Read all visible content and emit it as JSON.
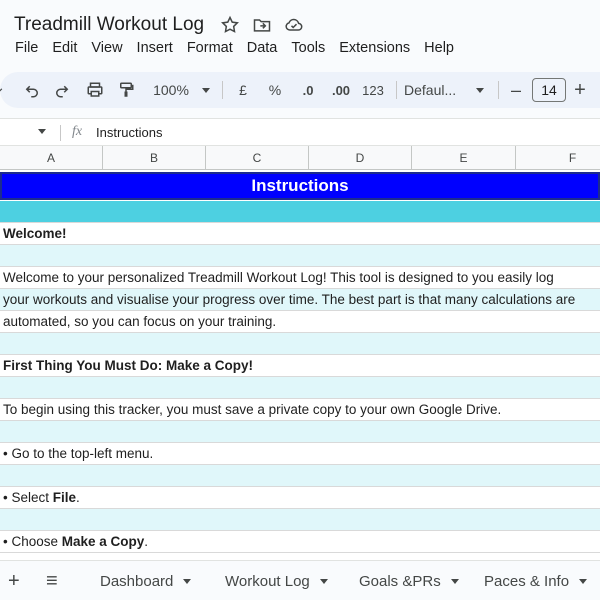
{
  "app": {
    "title": "Treadmill Workout Log"
  },
  "menu": [
    "File",
    "Edit",
    "View",
    "Insert",
    "Format",
    "Data",
    "Tools",
    "Extensions",
    "Help"
  ],
  "toolbar": {
    "zoom": "100%",
    "currency": "£",
    "percent": "%",
    "dec_decrease": ".0",
    "dec_increase": ".00",
    "number_format": "123",
    "font": "Defaul...",
    "font_size": "14",
    "minus": "–",
    "plus": "+"
  },
  "formula_bar": {
    "fx": "fx",
    "content": "Instructions"
  },
  "columns": [
    "A",
    "B",
    "C",
    "D",
    "E",
    "F"
  ],
  "rows": [
    {
      "text": "Instructions",
      "style": "header"
    },
    {
      "text": "",
      "style": "teal"
    },
    {
      "text": "Welcome!",
      "style": "light",
      "bold": true
    },
    {
      "text": "",
      "style": "cyan"
    },
    {
      "text": "Welcome to your personalized Treadmill Workout Log! This tool is designed to you easily log",
      "style": "light"
    },
    {
      "text": "your workouts and visualise your progress over time. The best part is that many calculations are",
      "style": "cyan"
    },
    {
      "text": "automated, so you can focus on your training.",
      "style": "light"
    },
    {
      "text": "",
      "style": "cyan"
    },
    {
      "text": "First Thing You Must Do: Make a Copy!",
      "style": "light",
      "bold": true
    },
    {
      "text": "",
      "style": "cyan"
    },
    {
      "text": "To begin using this tracker, you must save a private copy to your own Google Drive.",
      "style": "light"
    },
    {
      "text": "",
      "style": "cyan"
    },
    {
      "text": "• Go to the top-left menu.",
      "style": "light"
    },
    {
      "text": "",
      "style": "cyan"
    },
    {
      "text_prefix": "• Select ",
      "text_bold": "File",
      "text_suffix": ".",
      "style": "light"
    },
    {
      "text": "",
      "style": "cyan"
    },
    {
      "text_prefix": "• Choose ",
      "text_bold": "Make a Copy",
      "text_suffix": ".",
      "style": "light"
    }
  ],
  "sheets": {
    "add": "+",
    "list": "≡",
    "tabs": [
      "Dashboard",
      "Workout Log",
      "Goals &PRs",
      "Paces & Info"
    ]
  }
}
